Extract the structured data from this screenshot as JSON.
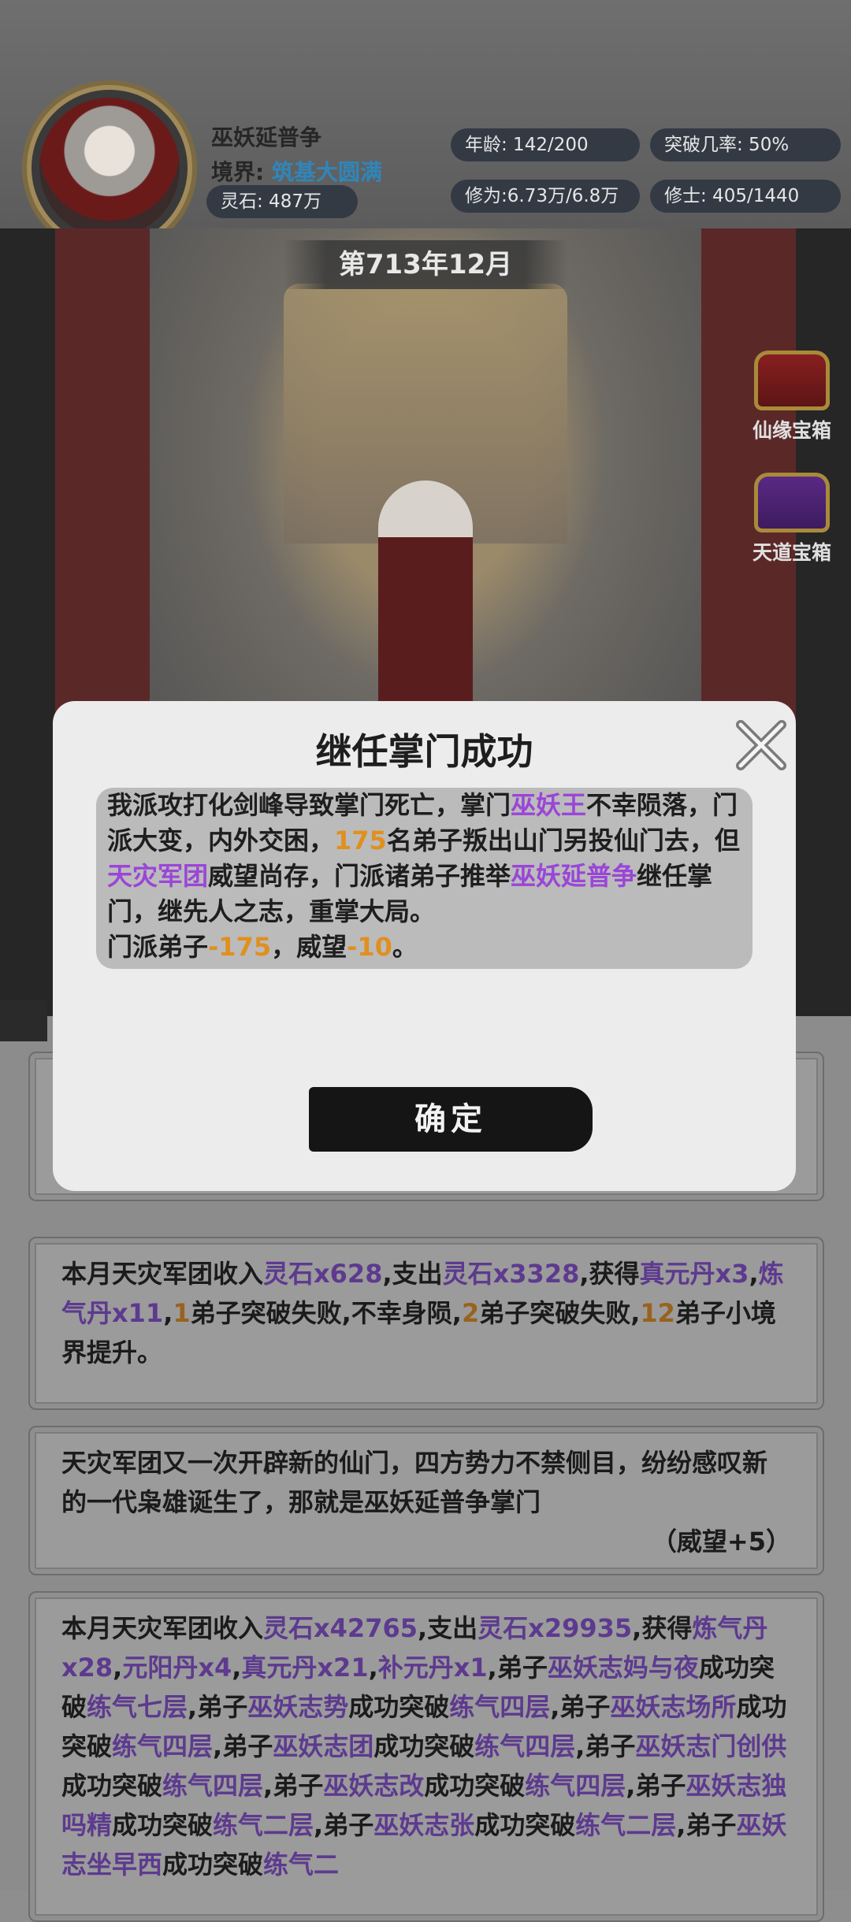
{
  "header": {
    "player_name": "巫妖延普争",
    "realm_label": "境界:",
    "realm_value": "筑基大圆满",
    "spirit_stone": "灵石: 487万",
    "age": "年龄:  142/200",
    "breakthrough": "突破几率:  50%",
    "cultivation": "修为:6.73万/6.8万",
    "disciples": "修士:  405/1440"
  },
  "scene": {
    "date": "第713年12月",
    "chest_xianyuan": "仙缘宝箱",
    "chest_tiandao": "天道宝箱"
  },
  "modal": {
    "title": "继任掌门成功",
    "body": {
      "s1": "我派攻打化剑峰导致掌门死亡，掌门",
      "hl1": "巫妖王",
      "s2": "不幸陨落，门派大变，内外交困，",
      "num1": "175",
      "s3": "名弟子叛出山门另投仙门去，但",
      "hl2": "天灾军团",
      "s4": "威望尚存，门派诸弟子推举",
      "hl3": "巫妖延普争",
      "s5": "继任掌门，继先人之志，重掌大局。",
      "s6": "门派弟子",
      "num2": "-175",
      "s7": "，威望",
      "num3": "-10",
      "s8": "。"
    },
    "confirm_label": "确定"
  },
  "log": {
    "income1": {
      "a": "本月天灾军团收入",
      "b": "灵石x628",
      "c": ",支出",
      "d": "灵石x3328",
      "e": ",获得",
      "f": "真元丹x3",
      "g": ",",
      "h": "炼气丹x11",
      "i": ",",
      "j": "1",
      "k": "弟子突破失败,不幸身陨,",
      "l": "2",
      "m": "弟子突破失败,",
      "n": "12",
      "o": "弟子小境界提升。"
    },
    "event": {
      "text": "天灾军团又一次开辟新的仙门，四方势力不禁侧目，纷纷感叹新的一代枭雄诞生了，那就是巫妖延普争掌门",
      "tag": "（威望+5）"
    },
    "income2": {
      "a": "本月天灾军团收入",
      "b": "灵石x42765",
      "c": ",支出",
      "d": "灵石x29935",
      "e": ",获得",
      "f": "炼气丹x28",
      "g": ",",
      "h": "元阳丹x4",
      "i": ",",
      "j": "真元丹x21",
      "k": ",",
      "l": "补元丹x1",
      "m": ",弟子",
      "n": "巫妖志妈与夜",
      "o": "成功突破",
      "p": "练气七层",
      "q": ",弟子",
      "r": "巫妖志势",
      "s": "成功突破",
      "t": "练气四层",
      "u": ",弟子",
      "v": "巫妖志场所",
      "w": "成功突破",
      "x": "练气四层",
      "y": ",弟子",
      "z": "巫妖志团",
      "aa": "成功突破",
      "ab": "练气四层",
      "ac": ",弟子",
      "ad": "巫妖志门创供",
      "ae": "成功突破",
      "af": "练气四层",
      "ag": ",弟子",
      "ah": "巫妖志改",
      "ai": "成功突破",
      "aj": "练气四层",
      "ak": ",弟子",
      "al": "巫妖志独吗精",
      "am": "成功突破",
      "an": "练气二层",
      "ao": ",弟子",
      "ap": "巫妖志张",
      "aq": "成功突破",
      "ar": "练气二层",
      "as": ",弟子",
      "at": "巫妖志坐早西",
      "au": "成功突破",
      "av": "练气二"
    }
  },
  "colors": {
    "highlight_purple": "#9a45d8",
    "highlight_orange": "#e0901e",
    "realm_blue": "#2f86ba"
  }
}
